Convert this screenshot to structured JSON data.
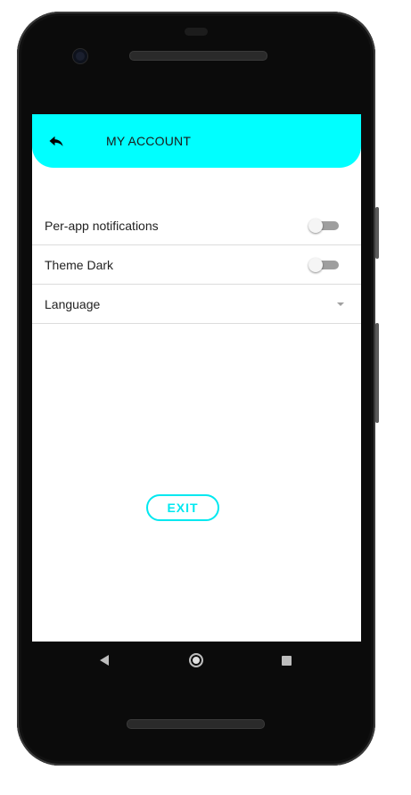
{
  "appbar": {
    "title": "MY ACCOUNT",
    "back_icon": "back-arrow-icon",
    "color": "#00ffff"
  },
  "settings": {
    "items": [
      {
        "label": "Per-app notifications",
        "control": "toggle",
        "enabled": false
      },
      {
        "label": "Theme Dark",
        "control": "toggle",
        "enabled": false
      },
      {
        "label": "Language",
        "control": "dropdown",
        "value": ""
      }
    ]
  },
  "exit_button": {
    "label": "EXIT",
    "color": "#00e8f0"
  },
  "navigation": {
    "back_icon": "nav-back-icon",
    "home_icon": "nav-home-icon",
    "recents_icon": "nav-recents-icon"
  }
}
